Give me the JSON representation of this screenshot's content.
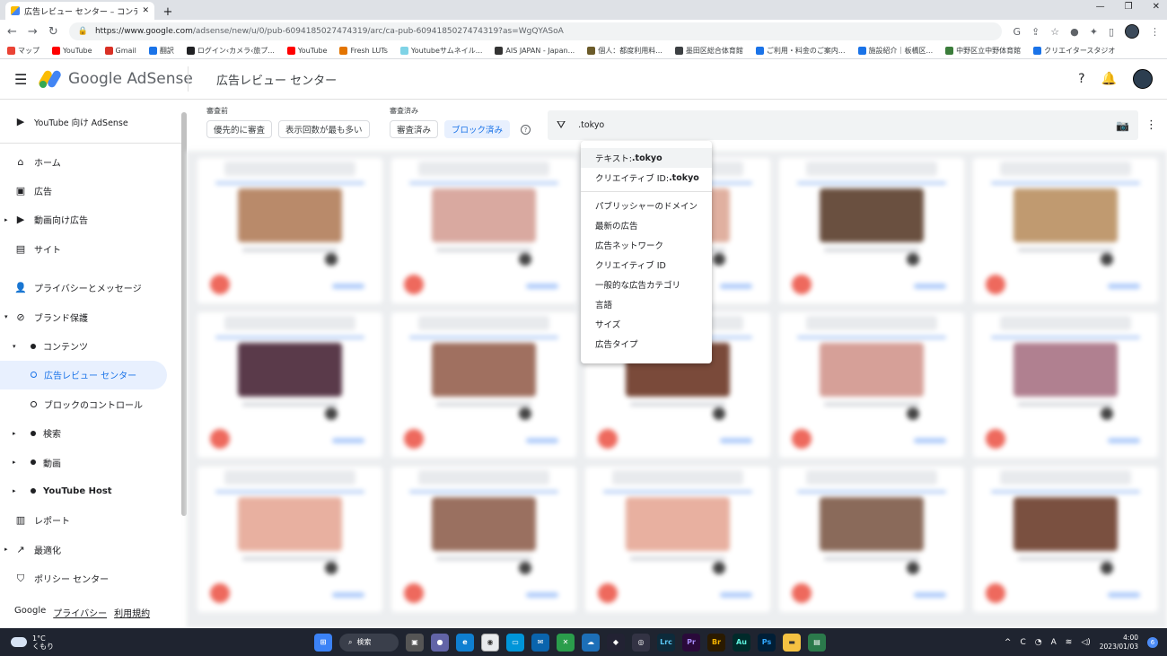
{
  "browser": {
    "tab_title": "広告レビュー センター – コンテンツ – ブ",
    "url_host": "https://www.google.com",
    "url_path": "/adsense/new/u/0/pub-6094185027474319/arc/ca-pub-6094185027474319?as=WgQYASoA",
    "bookmarks": [
      "マップ",
      "YouTube",
      "Gmail",
      "翻訳",
      "ログイン‹カメラ‹旅プ...",
      "YouTube",
      "Fresh LUTs",
      "Youtubeサムネイル...",
      "AIS JAPAN - Japan...",
      "個人：都度利用料...",
      "墨田区総合体育館",
      "ご利用・料金のご案内...",
      "施設紹介｜板橋区...",
      "中野区立中野体育館",
      "クリエイタースタジオ"
    ]
  },
  "app": {
    "logo_text": "Google AdSense",
    "page_title": "広告レビュー センター"
  },
  "sidebar": {
    "top_item": "YouTube 向け AdSense",
    "items": [
      {
        "label": "ホーム",
        "icon": "home-icon"
      },
      {
        "label": "広告",
        "icon": "ads-icon"
      },
      {
        "label": "動画向け広告",
        "icon": "video-ads-icon"
      },
      {
        "label": "サイト",
        "icon": "sites-icon"
      },
      {
        "label": "プライバシーとメッセージ",
        "icon": "privacy-icon"
      },
      {
        "label": "ブランド保護",
        "icon": "block-icon"
      },
      {
        "label": "コンテンツ",
        "icon": "dot-icon"
      },
      {
        "label": "広告レビュー センター",
        "icon": "ring-icon"
      },
      {
        "label": "ブロックのコントロール",
        "icon": "ring-icon"
      },
      {
        "label": "検索",
        "icon": "dot-icon"
      },
      {
        "label": "動画",
        "icon": "dot-icon"
      },
      {
        "label": "YouTube Host",
        "icon": "dot-icon"
      },
      {
        "label": "レポート",
        "icon": "reports-icon"
      },
      {
        "label": "最適化",
        "icon": "optimize-icon"
      },
      {
        "label": "ポリシー センター",
        "icon": "policy-icon"
      }
    ],
    "footer": [
      "Google",
      "プライバシー",
      "利用規約"
    ]
  },
  "filters": {
    "unreviewed_label": "審査前",
    "reviewed_label": "審査済み",
    "chips": [
      "優先的に審査",
      "表示回数が最も多い",
      "審査済み",
      "ブロック済み"
    ],
    "search_value": ".tokyo"
  },
  "dropdown": {
    "suggestions": [
      {
        "prefix": "テキスト: ",
        "value": ".tokyo"
      },
      {
        "prefix": "クリエイティブ ID: ",
        "value": ".tokyo"
      }
    ],
    "options": [
      "パブリッシャーのドメイン",
      "最新の広告",
      "広告ネットワーク",
      "クリエイティブ ID",
      "一般的な広告カテゴリ",
      "言語",
      "サイズ",
      "広告タイプ"
    ]
  },
  "taskbar": {
    "temp": "1°C",
    "weather": "くもり",
    "search_label": "検索",
    "apps": [
      "Lrc",
      "Pr",
      "Br",
      "Au",
      "Ps"
    ],
    "time": "4:00",
    "date": "2023/01/03",
    "notif_count": "6"
  }
}
